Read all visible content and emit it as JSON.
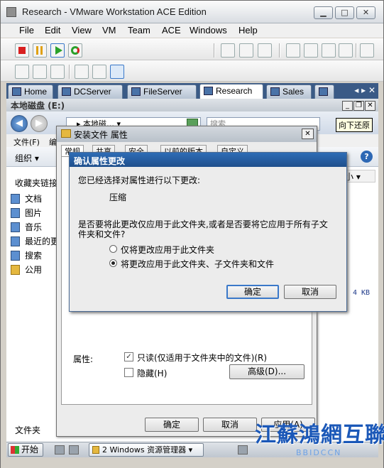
{
  "vm": {
    "title": "Research - VMware Workstation ACE Edition",
    "menu": [
      "File",
      "Edit",
      "View",
      "VM",
      "Team",
      "ACE",
      "Windows",
      "Help"
    ],
    "tabs": [
      {
        "label": "Home"
      },
      {
        "label": "DCServer"
      },
      {
        "label": "FileServer"
      },
      {
        "label": "Research",
        "active": true
      },
      {
        "label": "Sales"
      }
    ],
    "tab_nav": "◂ ▸ ✕"
  },
  "explorer": {
    "title": "本地磁盘 (E:)",
    "address": "▸ 本地磁… ▾",
    "search_placeholder": "搜索",
    "menu_file": "文件(F)",
    "menu_edit": "编",
    "organize": "组织",
    "favorites_header": "收藏夹链接",
    "favorites": [
      "文档",
      "图片",
      "音乐",
      "最近的更",
      "搜索",
      "公用"
    ],
    "folders_label": "文件夹",
    "col_size": "小",
    "file_size": "4 KB",
    "tooltip": "向下还原"
  },
  "properties": {
    "title": "安装文件 属性",
    "tabs": [
      "常规",
      "共享",
      "安全",
      "以前的版本",
      "自定义"
    ],
    "attributes_label": "属性:",
    "readonly_label": "只读(仅适用于文件夹中的文件)(R)",
    "hidden_label": "隐藏(H)",
    "advanced_button": "高级(D)...",
    "ok": "确定",
    "cancel": "取消",
    "apply": "应用(A)"
  },
  "confirm": {
    "title": "确认属性更改",
    "line1": "您已经选择对属性进行以下更改:",
    "change": "压缩",
    "question_line1": "是否要将此更改仅应用于此文件夹,或者是否要将它应用于所有子文",
    "question_line2": "件夹和文件?",
    "option1": "仅将更改应用于此文件夹",
    "option2": "将更改应用于此文件夹、子文件夹和文件",
    "selected_option": 2,
    "ok": "确定",
    "cancel": "取消"
  },
  "taskbar": {
    "start": "开始",
    "task": "2 Windows 资源管理器"
  },
  "watermark": {
    "text": "江蘇鴻網互聯",
    "sub": "BBIDCCN"
  }
}
